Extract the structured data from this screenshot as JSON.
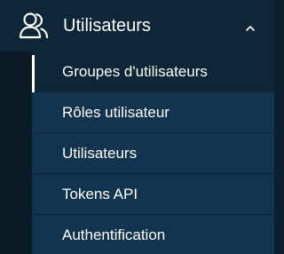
{
  "nav": {
    "section": {
      "label": "Utilisateurs",
      "icon": "users-icon",
      "expanded": true,
      "toggle_icon": "chevron-up-icon"
    },
    "items": [
      {
        "label": "Groupes d'utilisateurs",
        "active": true
      },
      {
        "label": "Rôles utilisateur",
        "active": false
      },
      {
        "label": "Utilisateurs",
        "active": false
      },
      {
        "label": "Tokens API",
        "active": false
      },
      {
        "label": "Authentification",
        "active": false
      }
    ]
  },
  "colors": {
    "header_bg": "#0f2638",
    "item_bg": "#13344e",
    "active_bg": "#0f2638",
    "rail_bg": "#0a1b26",
    "text": "#ffffff"
  }
}
